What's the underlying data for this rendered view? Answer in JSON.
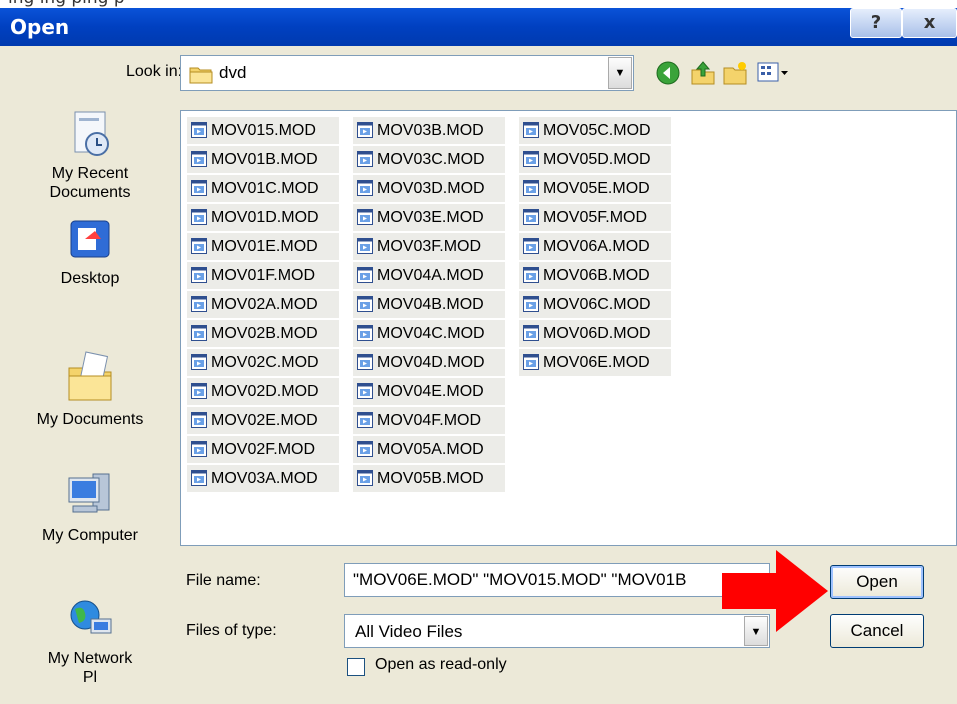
{
  "dialog": {
    "title": "Open",
    "help_label": "?",
    "close_label": "x"
  },
  "outside_caption": "ing ing ping p",
  "look_in": {
    "label": "Look in:",
    "value": "dvd"
  },
  "places": [
    {
      "label": "My Recent\nDocuments",
      "icon": "recent-documents-icon"
    },
    {
      "label": "Desktop",
      "icon": "desktop-icon"
    },
    {
      "label": "My Documents",
      "icon": "my-documents-icon"
    },
    {
      "label": "My Computer",
      "icon": "my-computer-icon"
    },
    {
      "label": "My Network\nPl",
      "icon": "my-network-icon"
    }
  ],
  "files": [
    [
      "MOV015.MOD",
      "MOV01B.MOD",
      "MOV01C.MOD",
      "MOV01D.MOD",
      "MOV01E.MOD",
      "MOV01F.MOD",
      "MOV02A.MOD",
      "MOV02B.MOD",
      "MOV02C.MOD",
      "MOV02D.MOD",
      "MOV02E.MOD",
      "MOV02F.MOD",
      "MOV03A.MOD"
    ],
    [
      "MOV03B.MOD",
      "MOV03C.MOD",
      "MOV03D.MOD",
      "MOV03E.MOD",
      "MOV03F.MOD",
      "MOV04A.MOD",
      "MOV04B.MOD",
      "MOV04C.MOD",
      "MOV04D.MOD",
      "MOV04E.MOD",
      "MOV04F.MOD",
      "MOV05A.MOD",
      "MOV05B.MOD"
    ],
    [
      "MOV05C.MOD",
      "MOV05D.MOD",
      "MOV05E.MOD",
      "MOV05F.MOD",
      "MOV06A.MOD",
      "MOV06B.MOD",
      "MOV06C.MOD",
      "MOV06D.MOD",
      "MOV06E.MOD"
    ]
  ],
  "file_name": {
    "label": "File name:",
    "value": "\"MOV06E.MOD\" \"MOV015.MOD\" \"MOV01B"
  },
  "file_type": {
    "label": "Files of type:",
    "value": "All Video Files"
  },
  "read_only": {
    "label": "Open as read-only",
    "checked": false
  },
  "buttons": {
    "open": "Open",
    "cancel": "Cancel"
  },
  "colors": {
    "title_bar": "#0040c0",
    "arrow": "#ff0000",
    "selection": "#ecece8"
  }
}
